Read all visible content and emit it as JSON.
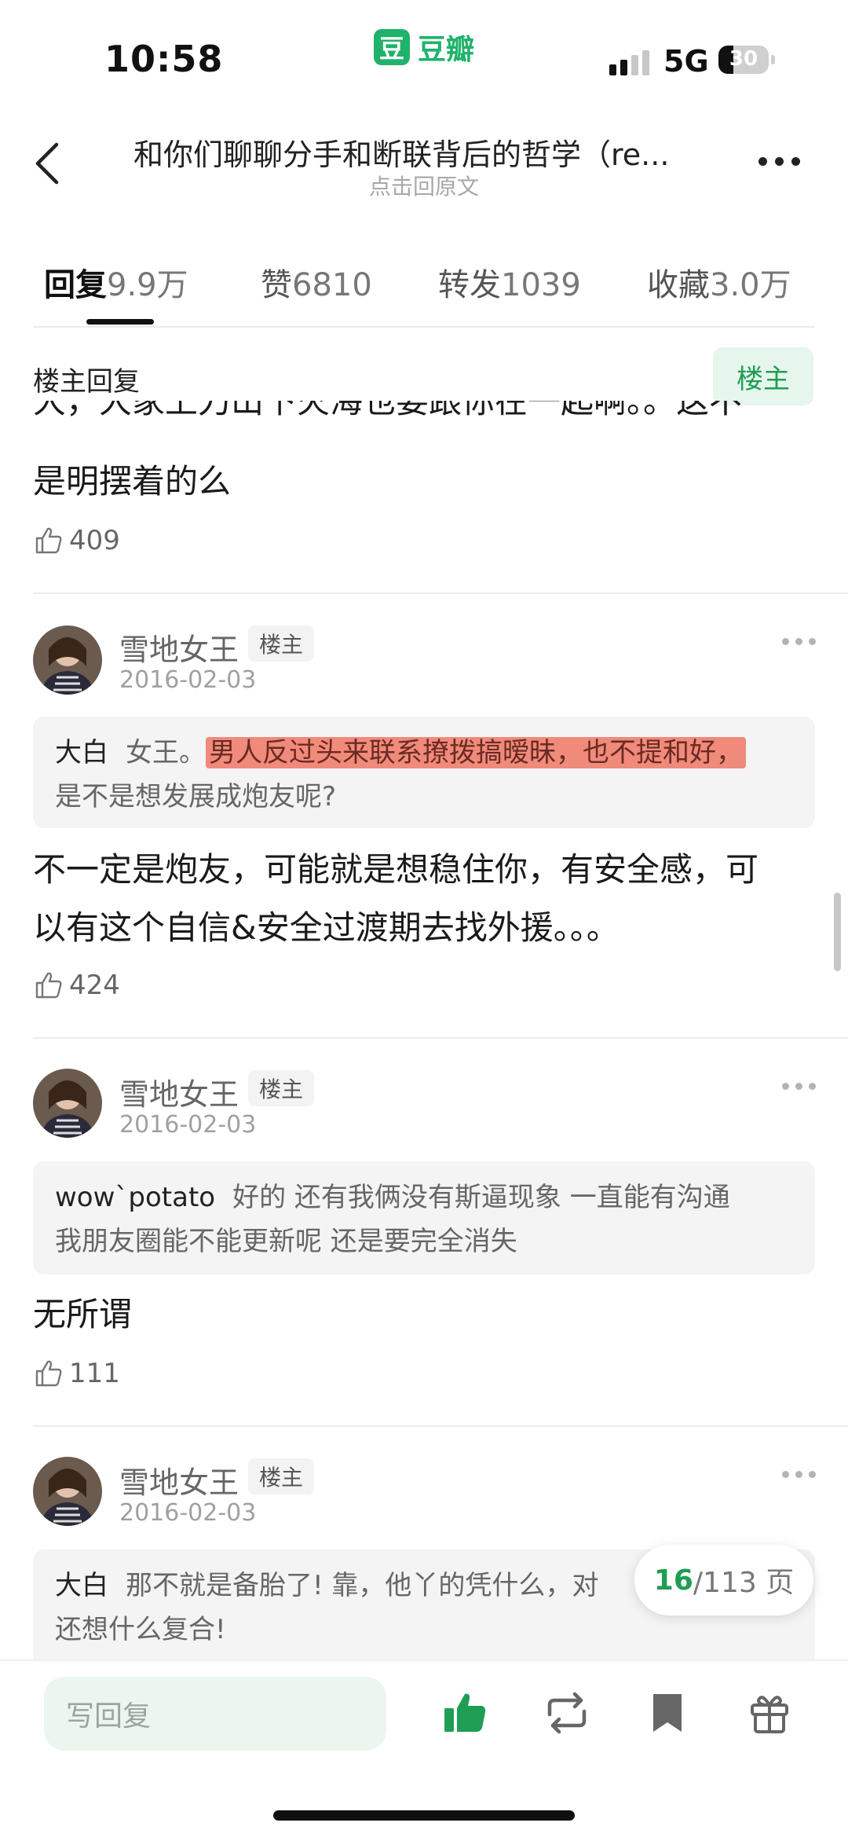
{
  "status_bar": {
    "time": "10:58",
    "app_logo": "豆",
    "app_name": "豆瓣",
    "network": "5G",
    "battery": "30",
    "battery_level_percent": 30
  },
  "nav": {
    "title": "和你们聊聊分手和断联背后的哲学（re...",
    "subtitle": "点击回原文"
  },
  "tabs": [
    {
      "label": "回复",
      "count": "9.9万"
    },
    {
      "label": "赞",
      "count": "6810"
    },
    {
      "label": "转发",
      "count": "1039"
    },
    {
      "label": "收藏",
      "count": "3.0万"
    }
  ],
  "section": {
    "title": "楼主回复",
    "op_filter_button": "楼主"
  },
  "partial_post": {
    "text_line1": "大，大家上刀山下火海也要跟你在一起啊。。这不",
    "text_line2": "是明摆着的么",
    "likes": "409"
  },
  "posts": [
    {
      "author": "雪地女王",
      "tag": "楼主",
      "date": "2016-02-03",
      "quote_name": "大白",
      "quote_text_plain": "女王。",
      "quote_text_highlight": "男人反过头来联系撩拨搞暧昧，也不提和好，",
      "quote_text_line2": "是不是想发展成炮友呢?",
      "body_line1": "不一定是炮友，可能就是想稳住你，有安全感，可",
      "body_line2": "以有这个自信&安全过渡期去找外援。。。",
      "likes": "424"
    },
    {
      "author": "雪地女王",
      "tag": "楼主",
      "date": "2016-02-03",
      "quote_name": "wow`potato",
      "quote_text_line1": "好的 还有我俩没有斯逼现象 一直能有沟通",
      "quote_text_line2": "我朋友圈能不能更新呢 还是要完全消失",
      "body": "无所谓",
      "likes": "111"
    },
    {
      "author": "雪地女王",
      "tag": "楼主",
      "date": "2016-02-03",
      "quote_name": "大白",
      "quote_text_line1": "那不就是备胎了! 靠，他丫的凭什么，对",
      "quote_text_line2": "还想什么复合!"
    }
  ],
  "pager": {
    "current": "16",
    "total": "/113 页"
  },
  "bottom_bar": {
    "reply_placeholder": "写回复"
  },
  "colors": {
    "accent_green": "#1f9d55",
    "highlight": "#f08a7a"
  }
}
